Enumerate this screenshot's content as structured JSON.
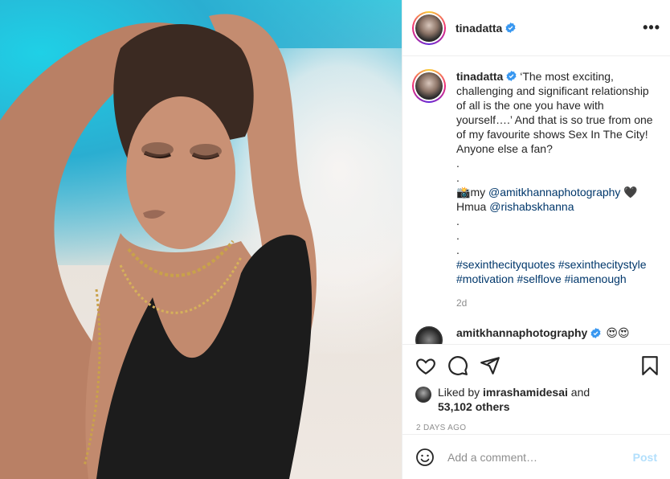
{
  "post": {
    "username": "tinadatta",
    "more_label": "•••",
    "caption": {
      "username": "tinadatta",
      "intro": " ‘The most exciting, challenging and significant relationship of all is the one you have with yourself….’ And that is so true from one of my favourite shows Sex In The City! Anyone else a fan?",
      "dots1": ".\n.",
      "camera_emoji": "📸",
      "credit_prefix": "my ",
      "credit_handle": "@amitkhannaphotography",
      "heart": " 🖤",
      "hmua_prefix": "\nHmua ",
      "hmua_handle": "@rishabskhanna",
      "dots2": "\n.\n.\n.\n",
      "hashtags": "#sexinthecityquotes #sexinthecitystyle #motivation #selflove #iamenough"
    },
    "caption_time": "2d",
    "comment_preview": {
      "username": "amitkhannaphotography",
      "emoji": "😍😍"
    },
    "likes": {
      "prefix": "Liked by ",
      "liker": "imrashamidesai",
      "middle": " and",
      "others": "53,102 others"
    },
    "date": "2 DAYS AGO",
    "comment_input": {
      "placeholder": "Add a comment…",
      "post_label": "Post"
    },
    "icons": [
      "heart-icon",
      "comment-icon",
      "share-icon",
      "bookmark-icon",
      "emoji-icon",
      "verified-icon",
      "more-icon"
    ],
    "colors": {
      "verified": "#3897f0",
      "link": "#00376b",
      "post_button": "#b2dffc",
      "muted": "#8e8e8e"
    }
  }
}
